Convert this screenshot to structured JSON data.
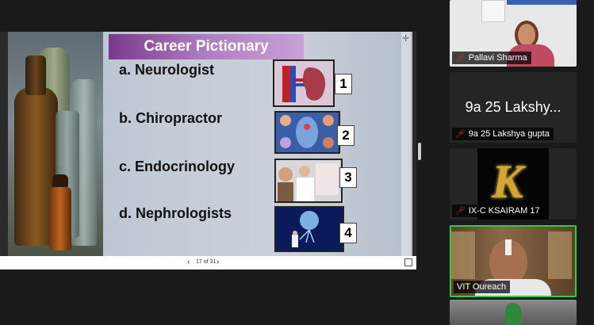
{
  "slide": {
    "title": "Career Pictionary",
    "items": [
      {
        "label": "a. Neurologist",
        "number": "1"
      },
      {
        "label": "b. Chiropractor",
        "number": "2"
      },
      {
        "label": "c. Endocrinology",
        "number": "3"
      },
      {
        "label": "d. Nephrologists",
        "number": "4"
      }
    ],
    "page_indicator": "17 of 31"
  },
  "participants": [
    {
      "name": "Pallavi Sharma",
      "muted": true
    },
    {
      "name": "9a 25 Lakshya gupta",
      "display": "9a 25 Lakshy...",
      "muted": true
    },
    {
      "name": "IX-C KSAIRAM 17",
      "muted": true
    },
    {
      "name": "VIT Oureach",
      "muted": false,
      "active_speaker": true
    }
  ],
  "colors": {
    "active_speaker_border": "#2ecc40",
    "muted_icon": "#e02b2b",
    "title_bar": "#9a5cb0"
  }
}
